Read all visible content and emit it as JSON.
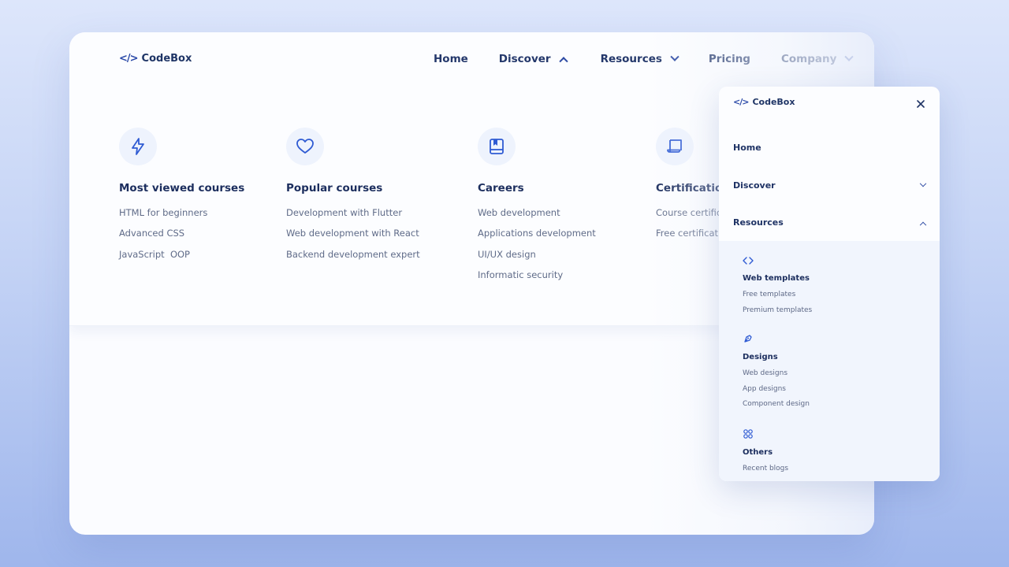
{
  "brand": {
    "name": "CodeBox",
    "icon": "code-brackets-icon"
  },
  "nav": [
    {
      "label": "Home",
      "has_chevron": false
    },
    {
      "label": "Discover",
      "has_chevron": true,
      "chevron": "up"
    },
    {
      "label": "Resources",
      "has_chevron": true,
      "chevron": "down"
    },
    {
      "label": "Pricing",
      "has_chevron": false
    },
    {
      "label": "Company",
      "has_chevron": true,
      "chevron": "down"
    }
  ],
  "discover_menu": [
    {
      "icon": "lightning-icon",
      "title": "Most viewed courses",
      "links": [
        "HTML for beginners",
        "Advanced CSS",
        "JavaScript  OOP"
      ]
    },
    {
      "icon": "heart-icon",
      "title": "Popular courses",
      "links": [
        "Development with Flutter",
        "Web development with React",
        "Backend development expert"
      ]
    },
    {
      "icon": "book-icon",
      "title": "Careers",
      "links": [
        "Web development",
        "Applications development",
        "UI/UX design",
        "Informatic security"
      ]
    },
    {
      "icon": "scroll-icon",
      "title": "Certification",
      "links": [
        "Course certific",
        "Free certificati"
      ]
    }
  ],
  "mobile": {
    "brand": "CodeBox",
    "close_icon": "close-icon",
    "items": [
      {
        "label": "Home"
      },
      {
        "label": "Discover",
        "chevron": "down"
      },
      {
        "label": "Resources",
        "chevron": "up"
      }
    ],
    "resources": [
      {
        "icon": "code-icon",
        "title": "Web templates",
        "links": [
          "Free templates",
          "Premium templates"
        ]
      },
      {
        "icon": "pen-icon",
        "title": "Designs",
        "links": [
          "Web designs",
          "App designs",
          "Component design"
        ]
      },
      {
        "icon": "grid-icon",
        "title": "Others",
        "links": [
          "Recent blogs"
        ]
      }
    ]
  },
  "colors": {
    "accent": "#2f5bd3",
    "text_dark": "#1c2b52",
    "text_muted": "#5f6b88",
    "icon_bg": "#eef3fd"
  }
}
